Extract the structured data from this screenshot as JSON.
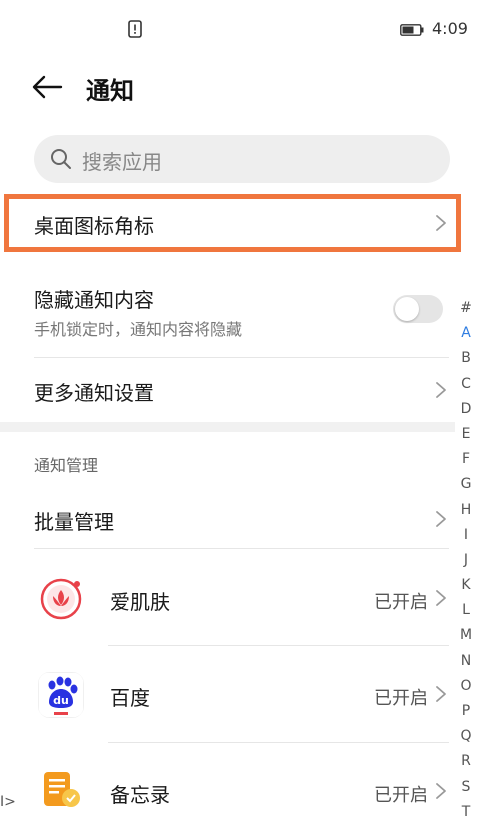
{
  "status_bar": {
    "time": "4:09",
    "left_icon": "notification-alert-icon",
    "battery_icon": "battery-icon"
  },
  "header": {
    "title": "通知",
    "back_icon": "back-arrow-icon"
  },
  "search": {
    "placeholder": "搜索应用"
  },
  "settings": {
    "badge_label": "桌面图标角标",
    "hide_label": "隐藏通知内容",
    "hide_sub": "手机锁定时，通知内容将隐藏",
    "hide_enabled": false,
    "more_label": "更多通知设置"
  },
  "section": {
    "title": "通知管理",
    "batch_label": "批量管理"
  },
  "apps": [
    {
      "name": "爱肌肤",
      "status": "已开启",
      "icon": "aijifu-app-icon",
      "color": "#e8424a"
    },
    {
      "name": "百度",
      "status": "已开启",
      "icon": "baidu-app-icon",
      "color": "#2932e1"
    },
    {
      "name": "备忘录",
      "status": "已开启",
      "icon": "memo-app-icon",
      "color": "#f39a1e"
    }
  ],
  "alphabet": [
    "#",
    "A",
    "B",
    "C",
    "D",
    "E",
    "F",
    "G",
    "H",
    "I",
    "J",
    "K",
    "L",
    "M",
    "N",
    "O",
    "P",
    "Q",
    "R",
    "S",
    "T"
  ],
  "alphabet_active": "A",
  "corner_glyph": "I>",
  "colors": {
    "highlight": "#f0763e",
    "accent": "#2f7de1"
  }
}
